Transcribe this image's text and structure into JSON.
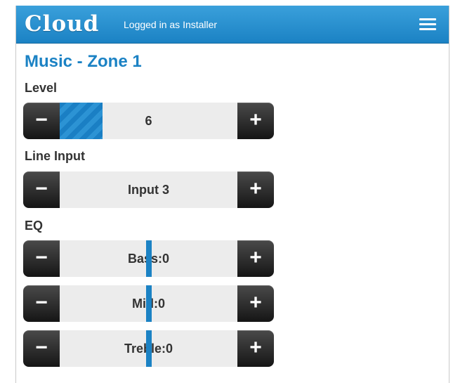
{
  "header": {
    "logo_text": "Cloud",
    "login_status": "Logged in as Installer",
    "menu_icon": "hamburger-menu-icon",
    "bar_color": "#1b82c4"
  },
  "zone": {
    "title": "Music - Zone 1"
  },
  "level": {
    "label": "Level",
    "value": "6",
    "fill_fraction": 0.24,
    "decrement_label": "−",
    "increment_label": "+"
  },
  "line_input": {
    "label": "Line Input",
    "value": "Input 3",
    "decrement_label": "−",
    "increment_label": "+"
  },
  "eq": {
    "label": "EQ",
    "bands": [
      {
        "name": "Bass",
        "display": "Bass:0",
        "value": 0,
        "decrement_label": "−",
        "increment_label": "+"
      },
      {
        "name": "Mid",
        "display": "Mid:0",
        "value": 0,
        "decrement_label": "−",
        "increment_label": "+"
      },
      {
        "name": "Treble",
        "display": "Treble:0",
        "value": 0,
        "decrement_label": "−",
        "increment_label": "+"
      }
    ]
  },
  "colors": {
    "accent": "#1b82c4",
    "button_dark": "#1e1e1e",
    "track": "#ececec",
    "label_text": "#333333"
  }
}
